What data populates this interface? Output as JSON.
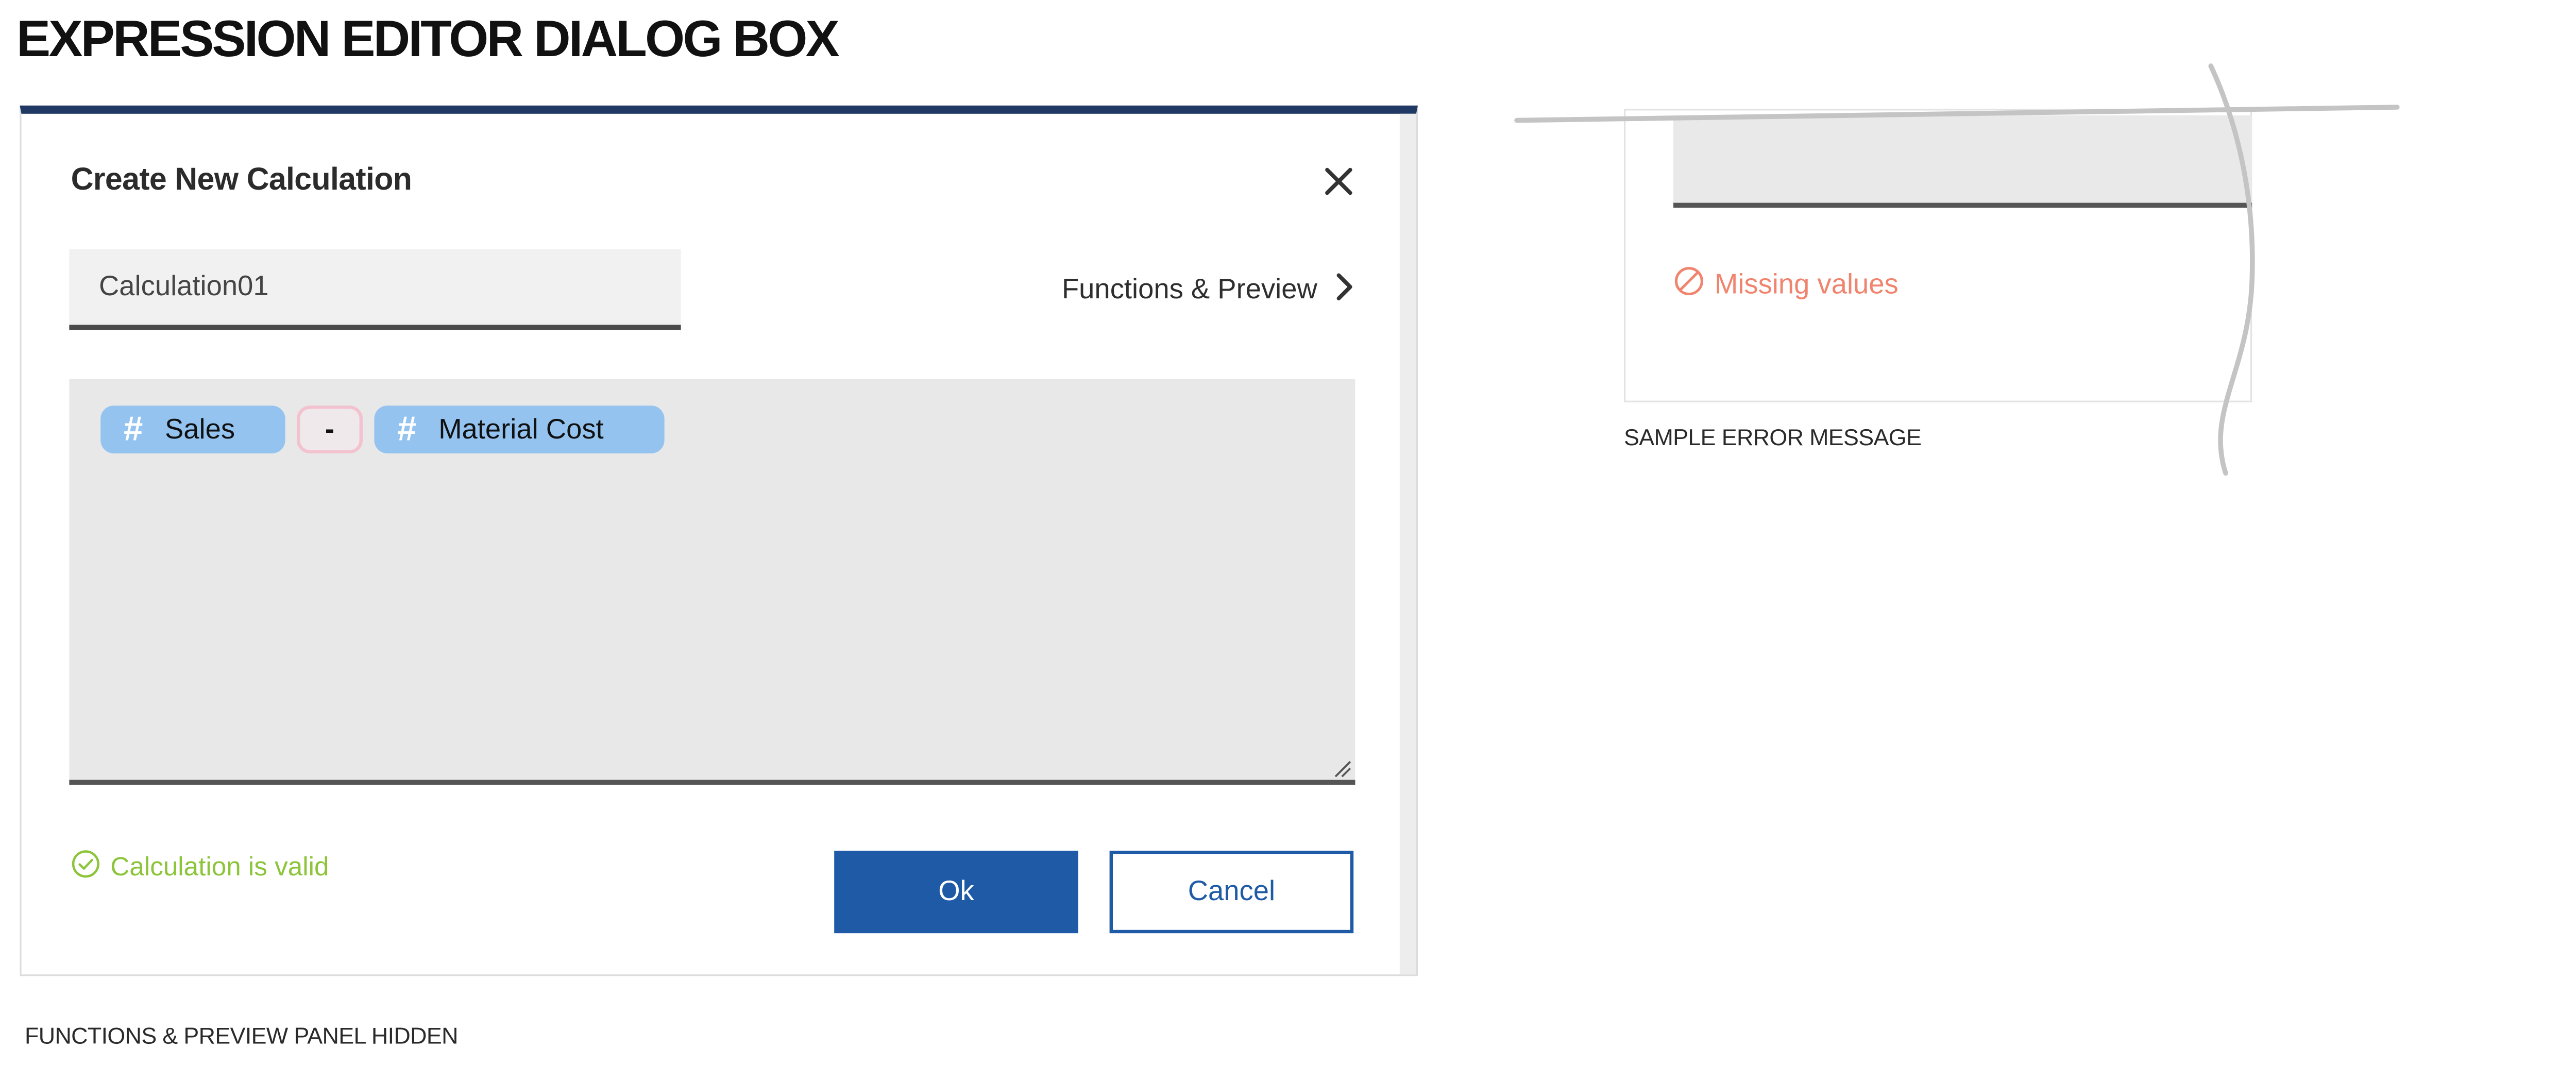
{
  "page": {
    "title": "EXPRESSION EDITOR DIALOG BOX"
  },
  "dialog": {
    "title": "Create New Calculation",
    "close_icon": "close-icon",
    "name_value": "Calculation01",
    "functions_link": "Functions & Preview",
    "functions_icon": "chevron-right-icon",
    "expression_tokens": [
      {
        "type": "field",
        "icon": "hash-icon",
        "label": "Sales"
      },
      {
        "type": "operator",
        "label": "-"
      },
      {
        "type": "field",
        "icon": "hash-icon",
        "label": "Material Cost"
      }
    ],
    "validation": {
      "icon": "check-circle-icon",
      "text": "Calculation is valid",
      "color": "#8cc43a"
    },
    "ok_label": "Ok",
    "cancel_label": "Cancel",
    "accent_color": "#1f5aa6",
    "header_bar_color": "#1f3864"
  },
  "captions": {
    "panel_hidden": "FUNCTIONS & PREVIEW PANEL HIDDEN",
    "sample_error": "SAMPLE ERROR MESSAGE"
  },
  "error_sample": {
    "icon": "prohibited-icon",
    "text": "Missing values",
    "color": "#f0846e"
  }
}
